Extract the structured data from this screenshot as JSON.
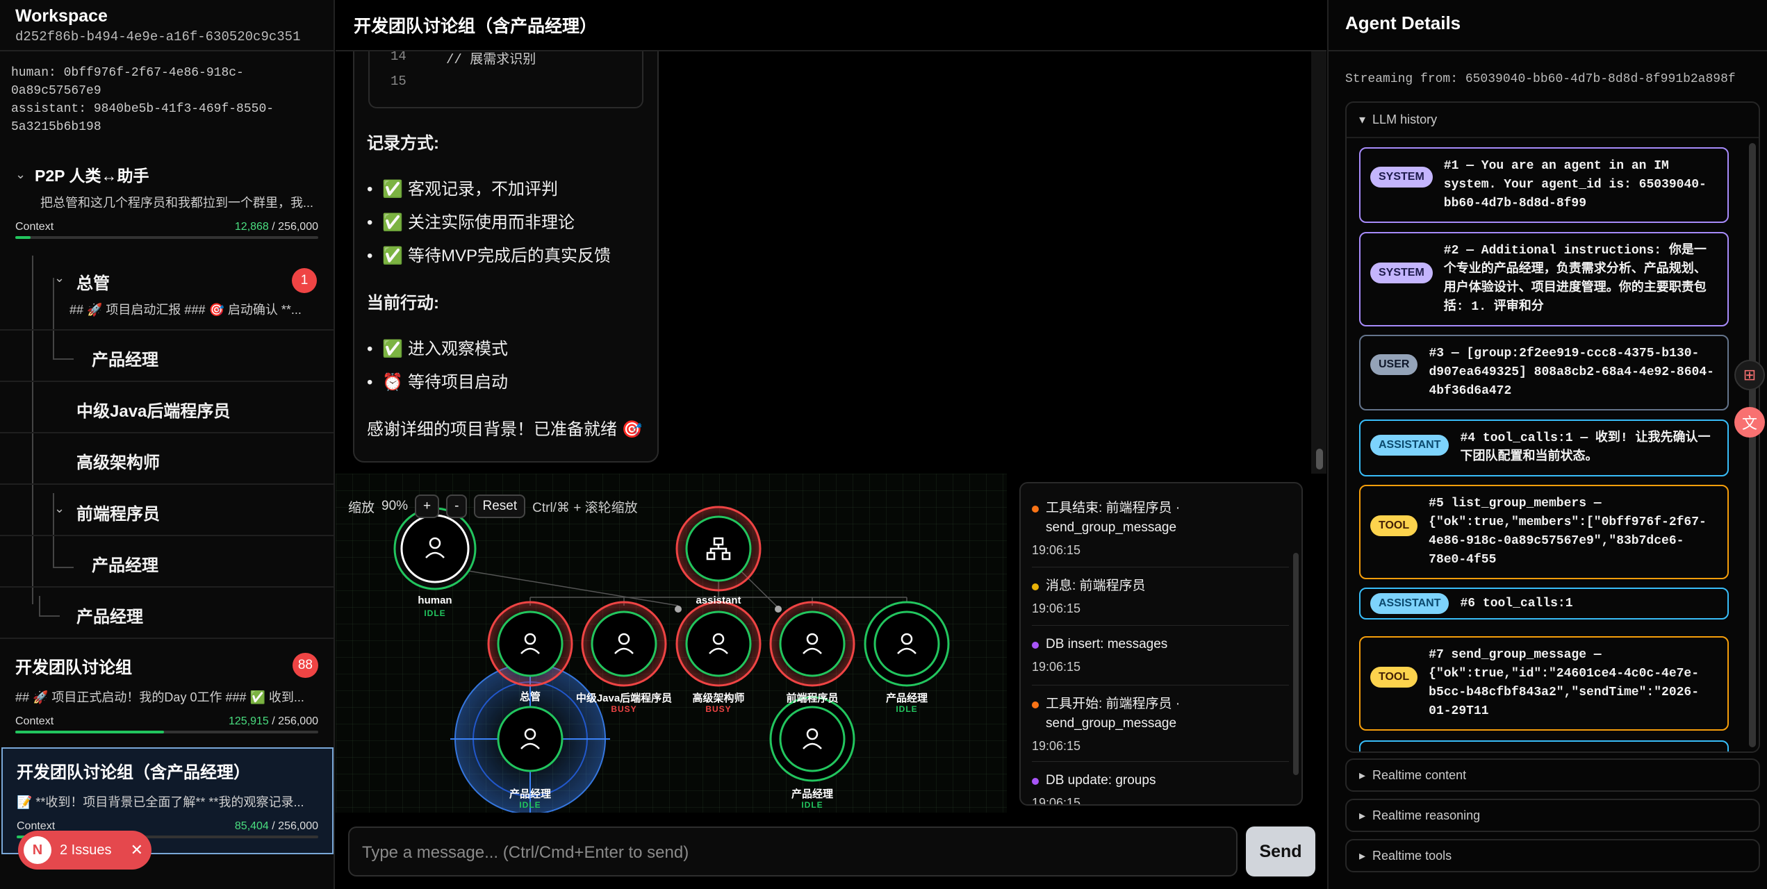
{
  "sidebar": {
    "workspace_title": "Workspace",
    "workspace_id": "d252f86b-b494-4e9e-a16f-630520c9c351",
    "human_id": "human: 0bff976f-2f67-4e86-918c-\n0a89c57567e9",
    "assistant_id": "assistant: 9840be5b-41f3-469f-8550-\n5a3215b6b198",
    "p2p": {
      "name": "P2P 人类↔助手",
      "preview": "把总管和这几个程序员和我都拉到一个群里，我...",
      "context_label": "Context",
      "context_value": "12,868",
      "context_total": " / 256,000",
      "context_fraction": 0.05
    },
    "tree": [
      {
        "label": "总管",
        "preview": "## 🚀 项目启动汇报 ### 🎯 启动确认 **...",
        "badge": "1"
      },
      {
        "label": "产品经理"
      },
      {
        "label": "中级Java后端程序员"
      },
      {
        "label": "高级架构师"
      },
      {
        "label": "前端程序员"
      },
      {
        "label": "产品经理"
      },
      {
        "label": "产品经理"
      }
    ],
    "dev_group": {
      "name": "开发团队讨论组",
      "badge": "88",
      "preview": "## 🚀 项目正式启动！我的Day 0工作 ### ✅ 收到...",
      "context_label": "Context",
      "context_value": "125,915",
      "context_total": " / 256,000",
      "context_fraction": 0.49
    },
    "dev_group_pm": {
      "name": "开发团队讨论组（含产品经理）",
      "preview": "📝 **收到！项目背景已全面了解** **我的观察记录...",
      "context_label": "Context",
      "context_value": "85,404",
      "context_total": " / 256,000",
      "context_fraction": 0.33
    }
  },
  "issues": {
    "letter": "N",
    "label": "2 Issues",
    "close": "✕"
  },
  "center": {
    "title": "开发团队讨论组（含产品经理）",
    "code_lines": [
      "14",
      "15"
    ],
    "code_fragment": "// 展需求识别",
    "record_heading": "记录方式:",
    "record_items": [
      "✅ 客观记录，不加评判",
      "✅ 关注实际使用而非理论",
      "✅ 等待MVP完成后的真实反馈"
    ],
    "action_heading": "当前行动:",
    "action_items": [
      "✅ 进入观察模式",
      "⏰ 等待项目启动"
    ],
    "closing": "感谢详细的项目背景！已准备就绪 🎯",
    "zoom": {
      "label": "缩放",
      "value": "90%",
      "plus": "+",
      "minus": "-",
      "reset": "Reset",
      "hint": "Ctrl/⌘ + 滚轮缩放"
    },
    "nodes": [
      {
        "label": "human",
        "status": "IDLE",
        "status_color": "#22c55e"
      },
      {
        "label": "assistant",
        "status": "",
        "status_color": "#22c55e"
      },
      {
        "label": "总管",
        "status": "",
        "status_color": "#22c55e"
      },
      {
        "label": "中级Java后端程序员",
        "status": "BUSY",
        "status_color": "#ef4444"
      },
      {
        "label": "高级架构师",
        "status": "BUSY",
        "status_color": "#ef4444"
      },
      {
        "label": "前端程序员",
        "status": "",
        "status_color": "#ef4444"
      },
      {
        "label": "产品经理",
        "status": "IDLE",
        "status_color": "#22c55e"
      },
      {
        "label": "产品经理",
        "status": "IDLE",
        "status_color": "#22c55e"
      },
      {
        "label": "产品经理",
        "status": "IDLE",
        "status_color": "#22c55e"
      }
    ],
    "events": [
      {
        "text": "工具结束: 前端程序员 · send_group_message",
        "time": "19:06:15",
        "color": "#f97316"
      },
      {
        "text": "消息: 前端程序员",
        "time": "19:06:15",
        "color": "#eab308"
      },
      {
        "text": "DB insert: messages",
        "time": "19:06:15",
        "color": "#a855f7"
      },
      {
        "text": "工具开始: 前端程序员 · send_group_message",
        "time": "19:06:15",
        "color": "#f97316"
      },
      {
        "text": "DB update: groups",
        "time": "19:06:15",
        "color": "#a855f7"
      }
    ],
    "composer_placeholder": "Type a message... (Ctrl/Cmd+Enter to send)",
    "send_label": "Send"
  },
  "right": {
    "title": "Agent Details",
    "streaming": "Streaming from: 65039040-bb60-4d7b-8d8d-8f991b2a898f",
    "history_title": "LLM history",
    "history": [
      {
        "role": "SYSTEM",
        "text": "#1 — You are an agent in an IM system. Your agent_id is: 65039040-bb60-4d7b-8d8d-8f99",
        "border": "#a78bfa",
        "bg": "#c4b5fd"
      },
      {
        "role": "SYSTEM",
        "text": "#2 — Additional instructions: 你是一个专业的产品经理，负责需求分析、产品规划、用户体验设计、项目进度管理。你的主要职责包括: 1. 评审和分",
        "border": "#a78bfa",
        "bg": "#c4b5fd"
      },
      {
        "role": "USER",
        "text": "#3 — [group:2f2ee919-ccc8-4375-b130-d907ea649325] 808a8cb2-68a4-4e92-8604-4bf36d6a472",
        "border": "#64748b",
        "bg": "#94a3b8"
      },
      {
        "role": "ASSISTANT",
        "text": "#4 tool_calls:1 — 收到! 让我先确认一下团队配置和当前状态。",
        "border": "#38bdf8",
        "bg": "#7dd3fc"
      },
      {
        "role": "TOOL",
        "text": "#5 list_group_members — {\"ok\":true,\"members\":[\"0bff976f-2f67-4e86-918c-0a89c57567e9\",\"83b7dce6-78e0-4f55",
        "border": "#f59e0b",
        "bg": "#fcd34d"
      },
      {
        "role": "ASSISTANT",
        "text": "#6 tool_calls:1",
        "border": "#38bdf8",
        "bg": "#7dd3fc"
      },
      {
        "role": "TOOL",
        "text": "#7 send_group_message — {\"ok\":true,\"id\":\"24601ce4-4c0c-4e7e-b5cc-b48cfbf843a2\",\"sendTime\":\"2026-01-29T11",
        "border": "#f59e0b",
        "bg": "#fcd34d"
      }
    ],
    "collapsibles": [
      "Realtime content",
      "Realtime reasoning",
      "Realtime tools"
    ]
  }
}
